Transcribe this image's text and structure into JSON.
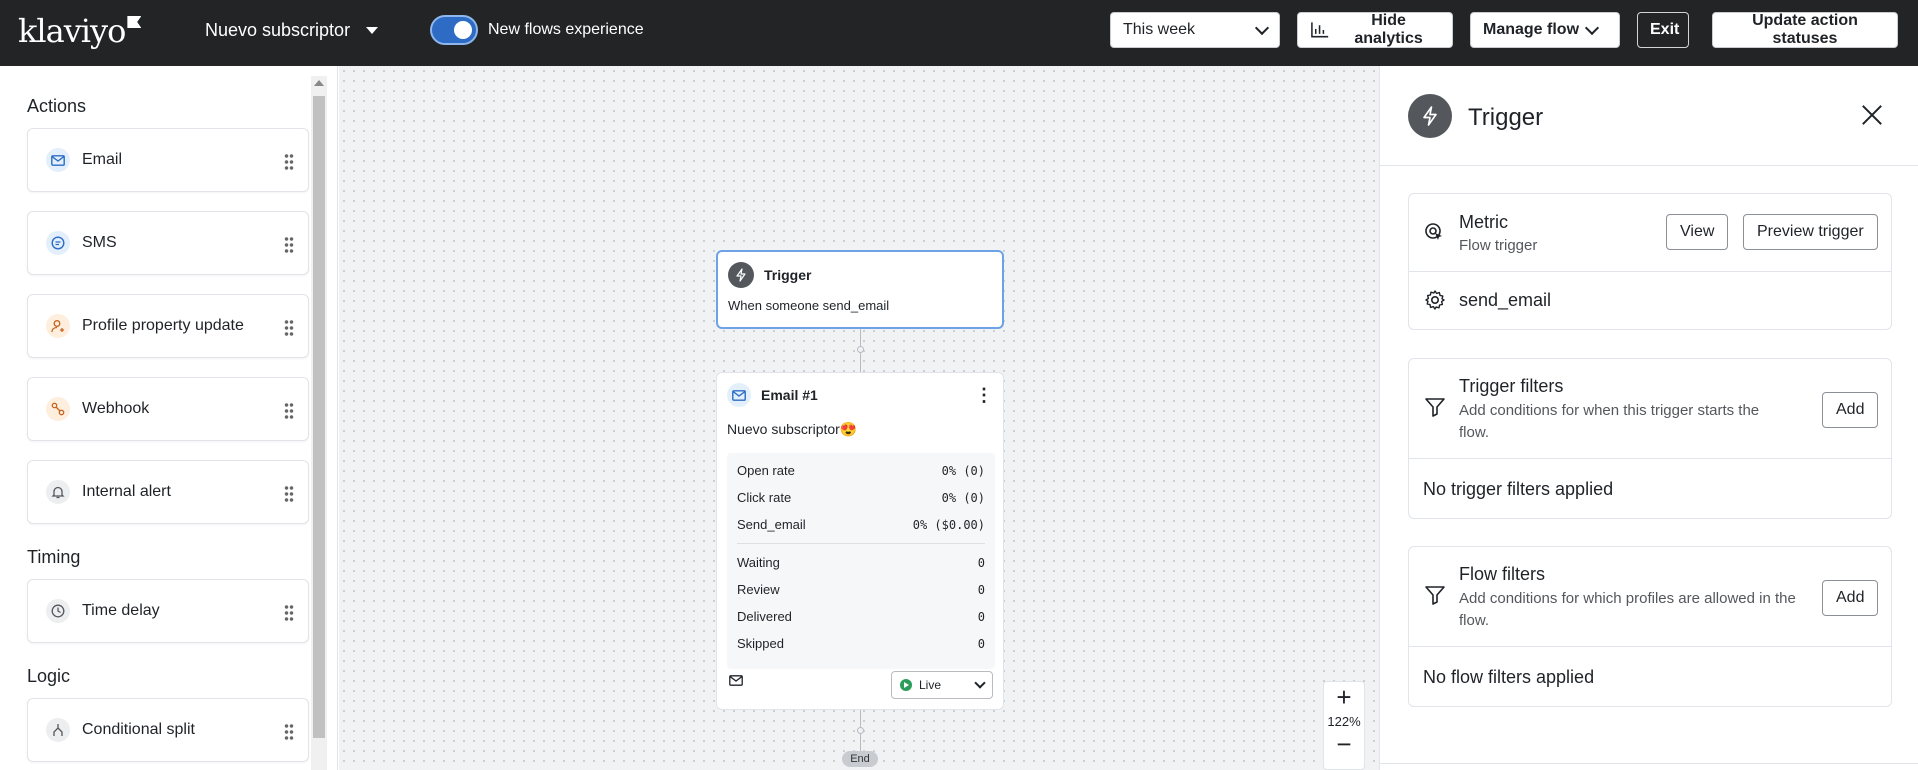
{
  "topbar": {
    "logo": "klaviyo",
    "flow_name": "Nuevo subscriptor",
    "toggle_label": "New flows experience",
    "date_range": "This week",
    "hide_analytics": "Hide analytics",
    "manage_flow": "Manage flow",
    "exit": "Exit",
    "update_statuses": "Update action statuses"
  },
  "sidebar": {
    "sections": {
      "actions": "Actions",
      "timing": "Timing",
      "logic": "Logic"
    },
    "items": [
      {
        "label": "Email",
        "icon": "email-icon"
      },
      {
        "label": "SMS",
        "icon": "sms-icon"
      },
      {
        "label": "Profile property update",
        "icon": "profile-icon"
      },
      {
        "label": "Webhook",
        "icon": "webhook-icon"
      },
      {
        "label": "Internal alert",
        "icon": "bell-icon"
      },
      {
        "label": "Time delay",
        "icon": "clock-icon"
      },
      {
        "label": "Conditional split",
        "icon": "split-icon"
      }
    ]
  },
  "canvas": {
    "trigger": {
      "title": "Trigger",
      "description": "When someone send_email"
    },
    "email": {
      "title": "Email #1",
      "subject": "Nuevo subscriptor😍",
      "stats": [
        {
          "label": "Open rate",
          "value": "0% (0)"
        },
        {
          "label": "Click rate",
          "value": "0% (0)"
        },
        {
          "label": "Send_email",
          "value": "0% ($0.00)"
        }
      ],
      "counts": [
        {
          "label": "Waiting",
          "value": "0"
        },
        {
          "label": "Review",
          "value": "0"
        },
        {
          "label": "Delivered",
          "value": "0"
        },
        {
          "label": "Skipped",
          "value": "0"
        }
      ],
      "status": "Live"
    },
    "end_label": "End",
    "zoom": "122%"
  },
  "panel": {
    "title": "Trigger",
    "metric": {
      "title": "Metric",
      "subtitle": "Flow trigger",
      "view": "View",
      "preview": "Preview trigger",
      "value": "send_email"
    },
    "trigger_filters": {
      "title": "Trigger filters",
      "subtitle": "Add conditions for when this trigger starts the flow.",
      "add": "Add",
      "empty": "No trigger filters applied"
    },
    "flow_filters": {
      "title": "Flow filters",
      "subtitle": "Add conditions for which profiles are allowed in the flow.",
      "add": "Add",
      "empty": "No flow filters applied"
    }
  },
  "colors": {
    "topbar_bg": "#232426",
    "toggle_on": "#2d6bc4",
    "selected_border": "#6ea2e6",
    "live_green": "#2c9c5a"
  }
}
